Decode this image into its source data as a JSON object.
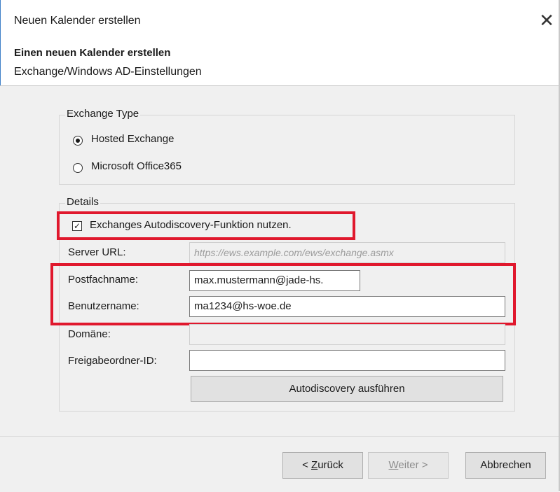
{
  "window": {
    "title": "Neuen Kalender erstellen",
    "close_symbol": "✕"
  },
  "header": {
    "title": "Einen neuen Kalender erstellen",
    "subtitle": "Exchange/Windows AD-Einstellungen"
  },
  "exchange_type": {
    "label": "Exchange Type",
    "options": [
      {
        "label": "Hosted Exchange",
        "selected": true
      },
      {
        "label": "Microsoft Office365",
        "selected": false
      }
    ]
  },
  "details": {
    "label": "Details",
    "autodiscovery_checkbox": {
      "label": "Exchanges Autodiscovery-Funktion nutzen.",
      "checked": true,
      "check_symbol": "✓"
    },
    "server_url": {
      "label": "Server URL:",
      "placeholder": "https://ews.example.com/ews/exchange.asmx",
      "value": ""
    },
    "postfachname": {
      "label": "Postfachname:",
      "value": "max.mustermann@jade-hs."
    },
    "benutzername": {
      "label": "Benutzername:",
      "value": "ma1234@hs-woe.de"
    },
    "domaene": {
      "label": "Domäne:",
      "value": ""
    },
    "freigabeordner": {
      "label": "Freigabeordner-ID:",
      "value": ""
    },
    "autodiscovery_button": "Autodiscovery ausführen"
  },
  "footer": {
    "back_prefix": "< ",
    "back_mnemonic": "Z",
    "back_rest": "urück",
    "next_mnemonic": "W",
    "next_rest": "eiter >",
    "cancel": "Abbrechen"
  },
  "colors": {
    "highlight": "#e0182d",
    "dialog_bg": "#f0f0f0",
    "window_edge": "#3c7fc7"
  }
}
